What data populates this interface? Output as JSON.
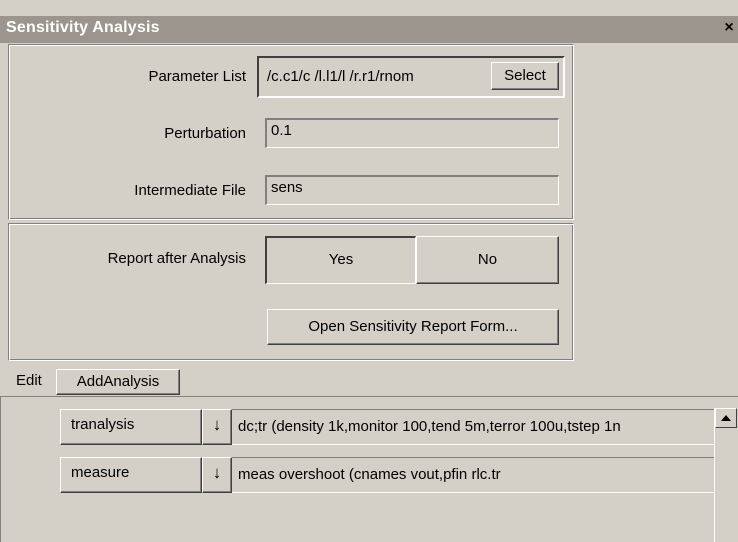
{
  "window": {
    "title": "Sensitivity Analysis",
    "close_glyph": "×"
  },
  "params": {
    "parameter_list_label": "Parameter List",
    "parameter_list_value": "/c.c1/c /l.l1/l /r.r1/rnom",
    "select_label": "Select",
    "perturbation_label": "Perturbation",
    "perturbation_value": "0.1",
    "intermediate_file_label": "Intermediate File",
    "intermediate_file_value": "sens"
  },
  "report": {
    "label": "Report after Analysis",
    "yes_label": "Yes",
    "no_label": "No",
    "selected": "Yes",
    "open_form_label": "Open Sensitivity Report Form..."
  },
  "menu": {
    "edit": "Edit",
    "add_analysis": "AddAnalysis"
  },
  "analyses": [
    {
      "type": "tranalysis",
      "arrow": "↓",
      "command": "dc;tr (density 1k,monitor 100,tend 5m,terror 100u,tstep 1n"
    },
    {
      "type": "measure",
      "arrow": "↓",
      "command": "meas overshoot (cnames vout,pfin rlc.tr"
    }
  ],
  "icons": {
    "close": "close-icon",
    "scroll_up": "scroll-up-arrow-icon"
  }
}
